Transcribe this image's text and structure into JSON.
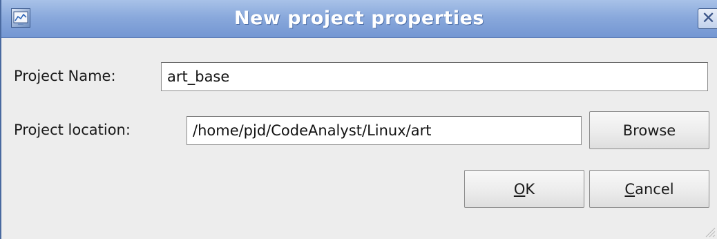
{
  "window": {
    "title": "New project properties",
    "close_glyph": "✕",
    "icon": "project-app-icon"
  },
  "form": {
    "name_label": "Project Name:",
    "name_value": "art_base",
    "location_label": "Project location:",
    "location_value": "/home/pjd/CodeAnalyst/Linux/art"
  },
  "buttons": {
    "browse_label": "Browse",
    "ok_mnemonic": "O",
    "ok_rest": "K",
    "cancel_mnemonic": "C",
    "cancel_rest": "ancel"
  },
  "colors": {
    "titlebar": "#8aa9dc",
    "window_bg": "#ededed",
    "title_text": "#ffffff"
  }
}
